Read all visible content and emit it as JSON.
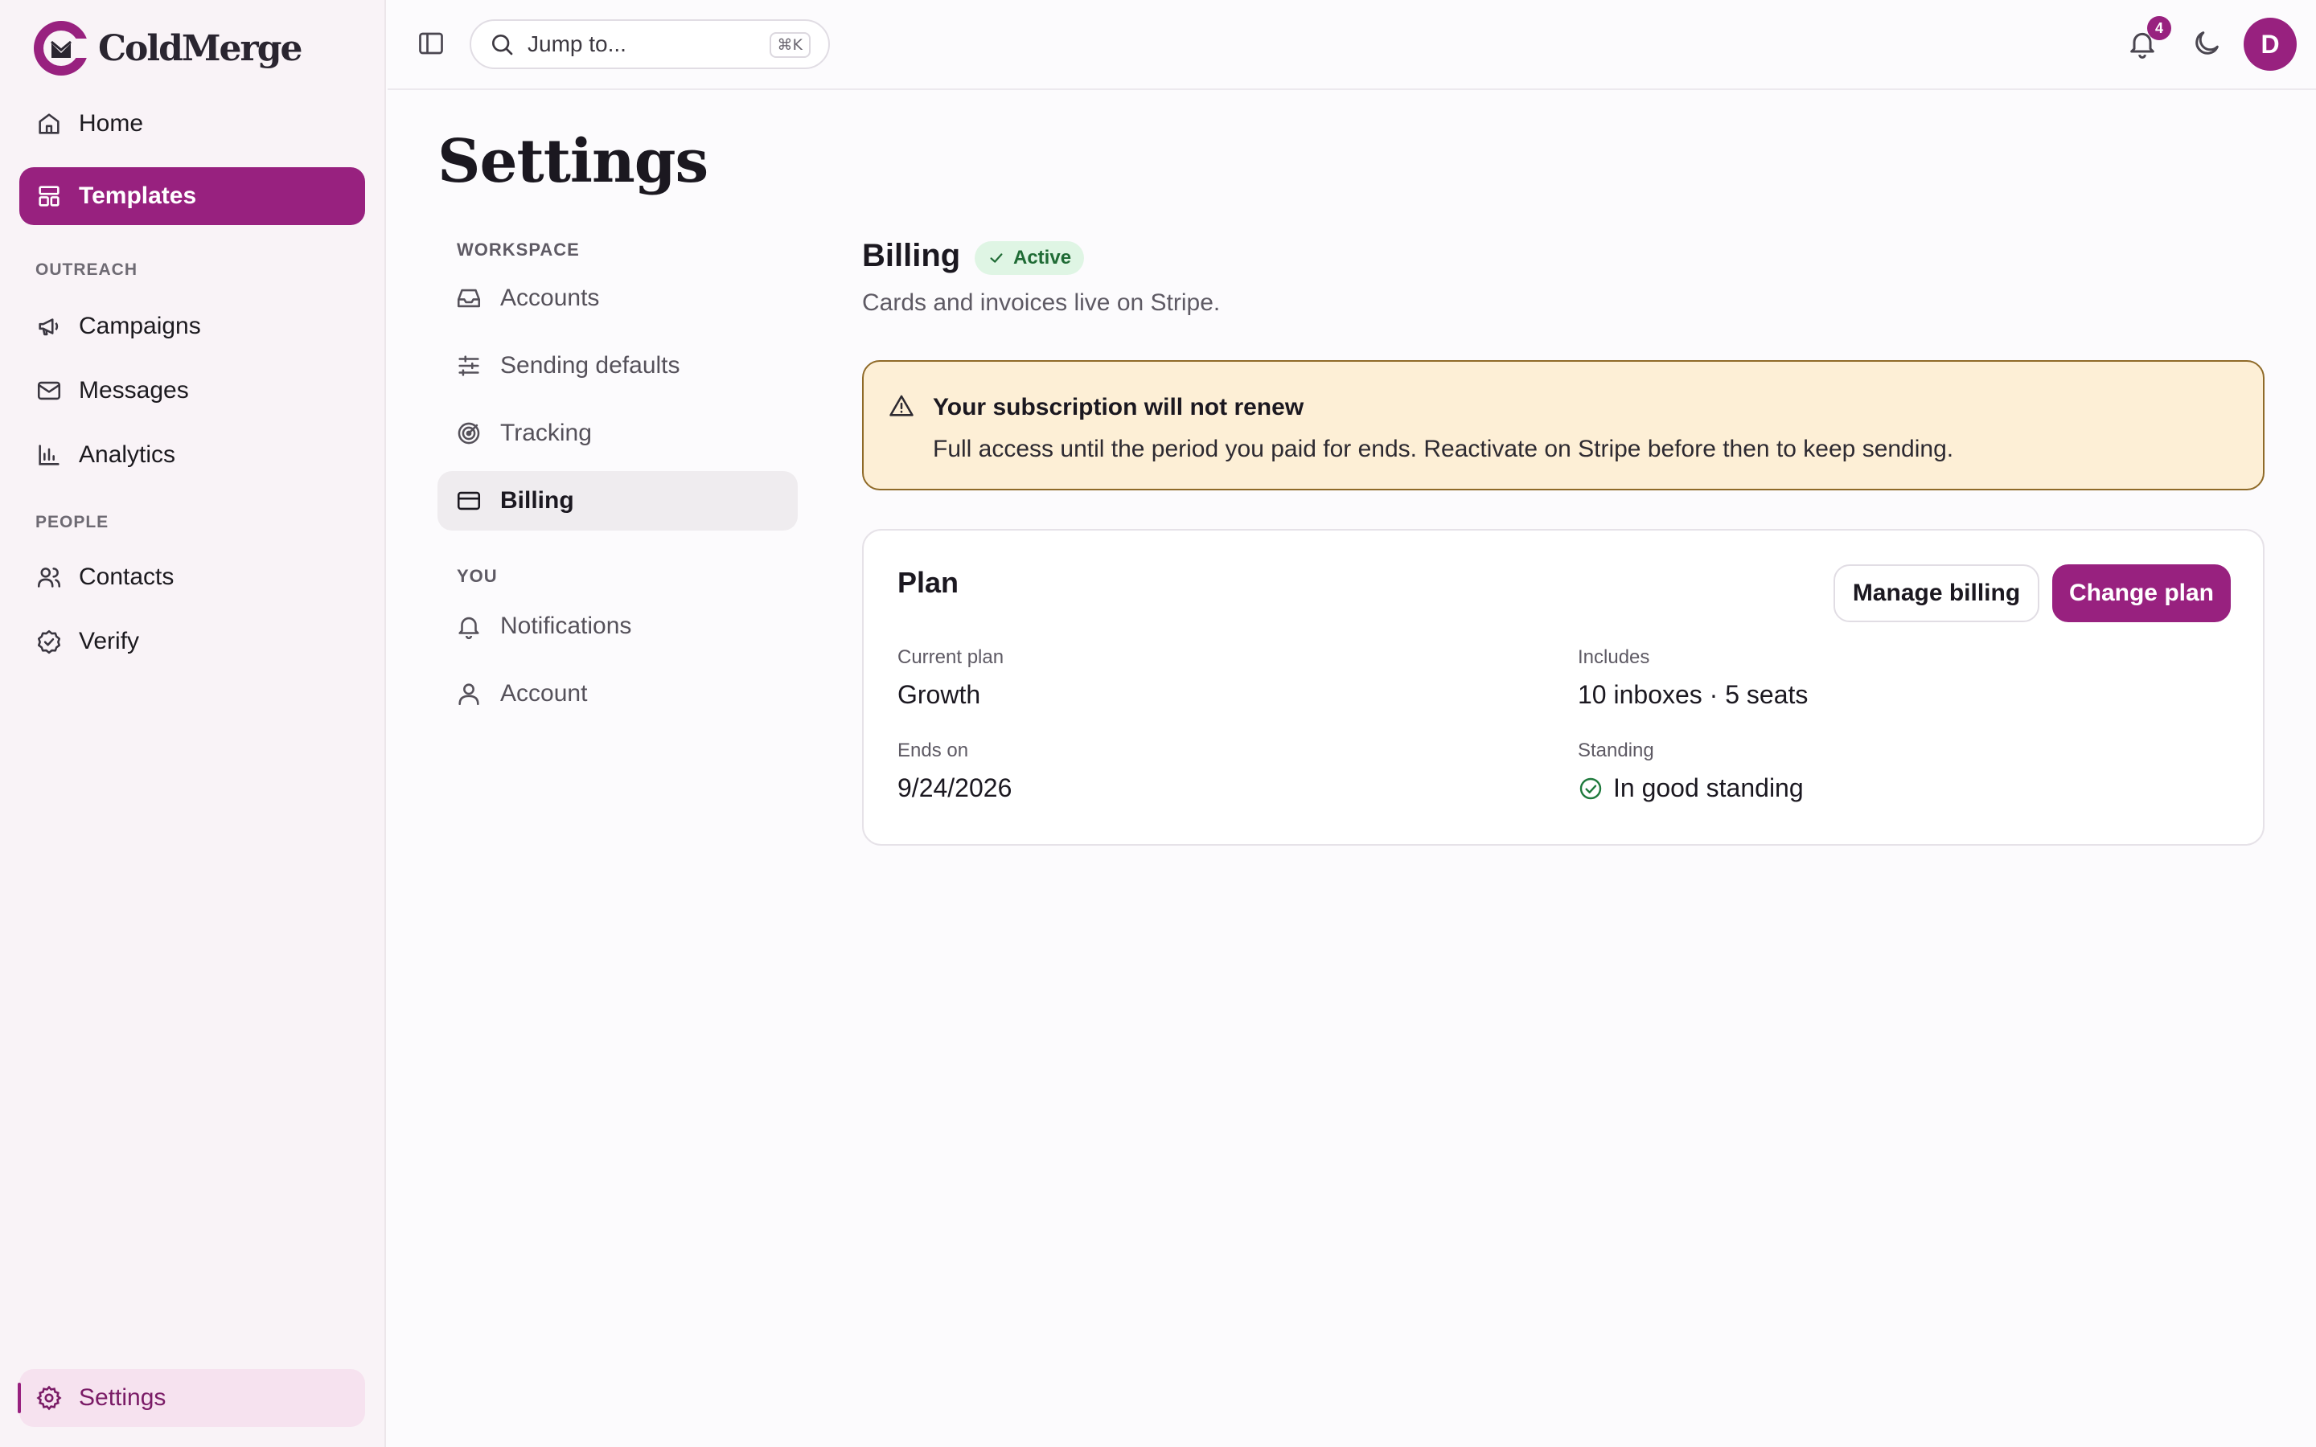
{
  "brand": {
    "name": "ColdMerge",
    "accent": "#98217f"
  },
  "sidebar": {
    "items_top": [
      {
        "label": "Home",
        "icon": "home-icon"
      },
      {
        "label": "Templates",
        "icon": "templates-icon",
        "active": true
      }
    ],
    "sections": [
      {
        "label": "OUTREACH",
        "items": [
          {
            "label": "Campaigns",
            "icon": "megaphone-icon"
          },
          {
            "label": "Messages",
            "icon": "mail-icon"
          },
          {
            "label": "Analytics",
            "icon": "bar-chart-icon"
          }
        ]
      },
      {
        "label": "PEOPLE",
        "items": [
          {
            "label": "Contacts",
            "icon": "users-icon"
          },
          {
            "label": "Verify",
            "icon": "check-circle-icon"
          }
        ]
      }
    ],
    "bottom_item": {
      "label": "Settings",
      "icon": "gear-icon"
    }
  },
  "topbar": {
    "search_placeholder": "Jump to...",
    "search_shortcut": "⌘K",
    "notifications_count": "4",
    "avatar_initial": "D"
  },
  "page": {
    "title": "Settings"
  },
  "settings_nav": {
    "sections": [
      {
        "label": "WORKSPACE",
        "items": [
          {
            "label": "Accounts",
            "icon": "inbox-icon"
          },
          {
            "label": "Sending defaults",
            "icon": "sliders-icon"
          },
          {
            "label": "Tracking",
            "icon": "target-icon"
          },
          {
            "label": "Billing",
            "icon": "credit-card-icon",
            "active": true
          }
        ]
      },
      {
        "label": "YOU",
        "items": [
          {
            "label": "Notifications",
            "icon": "bell-icon"
          },
          {
            "label": "Account",
            "icon": "user-icon"
          }
        ]
      }
    ]
  },
  "billing": {
    "title": "Billing",
    "status": "Active",
    "subtitle": "Cards and invoices live on Stripe.",
    "alert": {
      "title": "Your subscription will not renew",
      "body": "Full access until the period you paid for ends. Reactivate on Stripe before then to keep sending."
    },
    "plan": {
      "title": "Plan",
      "manage_label": "Manage billing",
      "change_label": "Change plan",
      "current_plan_label": "Current plan",
      "current_plan_value": "Growth",
      "includes_label": "Includes",
      "includes_value": "10 inboxes · 5 seats",
      "ends_label": "Ends on",
      "ends_value": "9/24/2026",
      "standing_label": "Standing",
      "standing_value": "In good standing"
    }
  }
}
